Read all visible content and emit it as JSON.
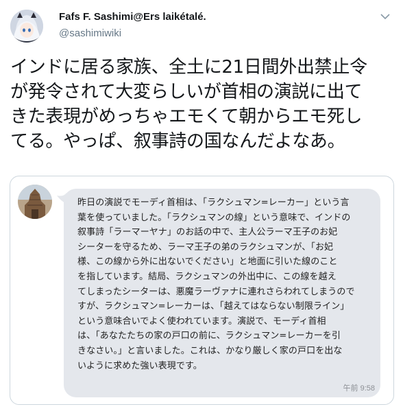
{
  "author": {
    "display_name": "Fafs F. Sashimi@Ers laikétalé.",
    "handle": "@sashimiwiki",
    "avatar_icon": "anime-character-avatar"
  },
  "menu": {
    "icon": "chevron-down-icon"
  },
  "tweet": {
    "text": "インドに居る家族、全土に21日間外出禁止令\nが発令されて大変らしいが首相の演説に出て\nきた表現がめっちゃエモくて朝からエモ死し\nてる。やっぱ、叙事詩の国なんだよなあ。"
  },
  "media": {
    "avatar_icon": "temple-photo-avatar",
    "message": "昨日の演説でモーディ首相は、「ラクシュマン=レーカー」という言\n葉を使っていました。「ラクシュマンの線」という意味で、インドの\n叙事詩「ラーマーヤナ」のお話の中で、主人公ラーマ王子のお妃\nシーターを守るため、ラーマ王子の弟のラクシュマンが、「お妃\n様、この線から外に出ないでください」と地面に引いた線のこと\nを指しています。結局、ラクシュマンの外出中に、この線を越え\nてしまったシーターは、悪魔ラーヴァナに連れさらわれてしまうので\nすが、ラクシュマン=レーカーは、「越えてはならない制限ライン」\nという意味合いでよく使われています。演説で、モーディ首相\nは、「あなたたちの家の戸口の前に、ラクシュマン=レーカーを引\nきなさい。」と言いました。これは、かなり厳しく家の戸口を出な\nいように求めた強い表現です。",
    "timestamp": "午前 9:58"
  },
  "colors": {
    "name": "#14171a",
    "handle": "#657786",
    "bubble": "#e4e7ec",
    "border": "#ccd6dd"
  }
}
